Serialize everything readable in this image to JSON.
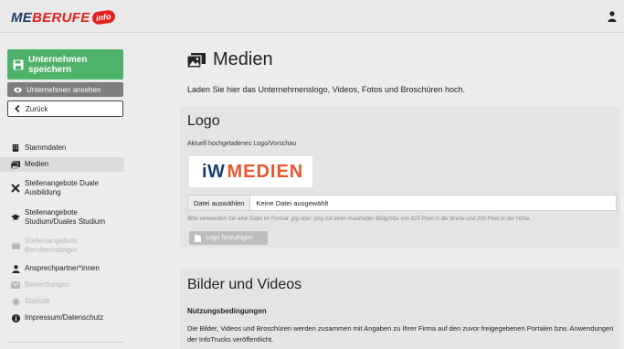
{
  "header": {
    "logo_me": "ME",
    "logo_berufe": "BERUFE",
    "logo_badge": "info"
  },
  "sidebar": {
    "save_button": "Unternehmen speichern",
    "view_button": "Unternehmen ansehen",
    "back_button": "Zurück",
    "items": [
      {
        "label": "Stammdaten",
        "icon": "building-icon"
      },
      {
        "label": "Medien",
        "icon": "images-icon"
      },
      {
        "label": "Stellenangebote Duale Ausbildung",
        "icon": "tools-icon"
      },
      {
        "label": "Stellenangebote Studium/Duales Studium",
        "icon": "graduation-cap-icon"
      },
      {
        "label": "Stellenangebote Berufseinsteiger",
        "icon": "briefcase-icon"
      },
      {
        "label": "Ansprechpartner*innen",
        "icon": "user-icon"
      },
      {
        "label": "Bewerbungen",
        "icon": "inbox-icon"
      },
      {
        "label": "Statistik",
        "icon": "cog-icon"
      },
      {
        "label": "Impressum/Datenschutz",
        "icon": "info-icon"
      }
    ]
  },
  "main": {
    "title": "Medien",
    "intro": "Laden Sie hier das Unternehmenslogo, Videos, Fotos und Broschüren hoch.",
    "logo_section": {
      "title": "Logo",
      "caption": "Aktuell hochgeladenes Logo/Vorschau",
      "preview_iw": "iW",
      "preview_medien": "MEDIEN",
      "choose_file": "Datei auswählen",
      "no_file": "Keine Datei ausgewählt",
      "hint": "Bitte verwenden Sie eine Datei im Format .jpg oder .png mit einer maximalen Bildgröße von 625 Pixel in der Breite und 200 Pixel in der Höhe.",
      "add_button": "Logo hinzufügen"
    },
    "media_section": {
      "title": "Bilder und Videos",
      "terms_heading": "Nutzungsbedingungen",
      "terms_text": "Die Bilder, Videos und Broschüren werden zusammen mit Angaben zu Ihrer Firma auf den zuvor freigegebenen Portalen bzw. Anwendungen der InfoTrucks veröffentlicht."
    }
  },
  "colors": {
    "save_green": "#4fb26a",
    "view_gray": "#7e7e7e",
    "brand_red": "#e2211c",
    "brand_navy": "#1d3a6b"
  }
}
